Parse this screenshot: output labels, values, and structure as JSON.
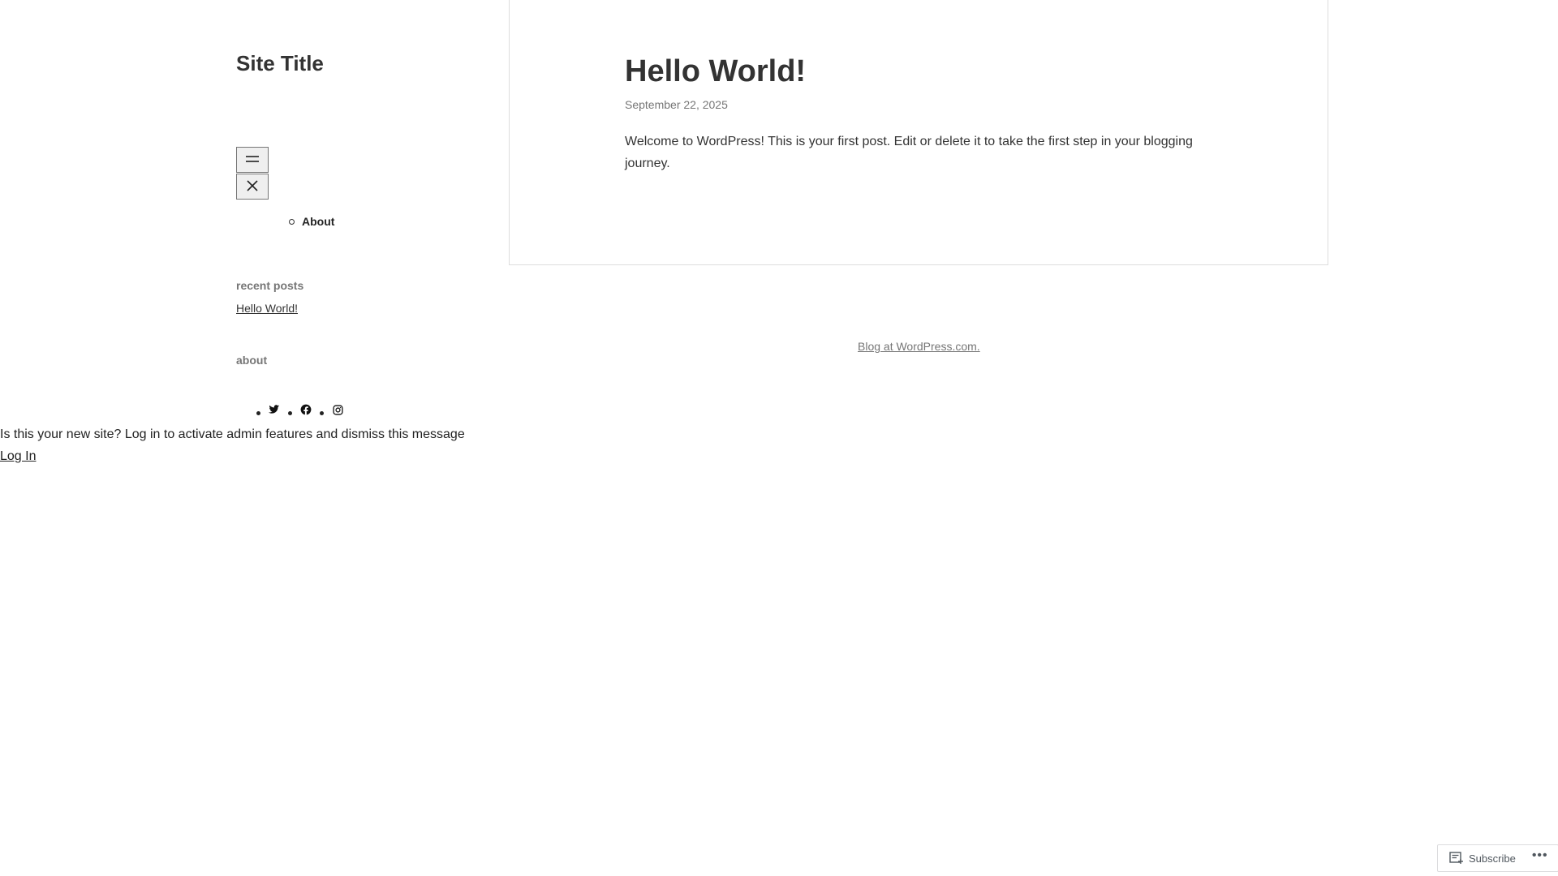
{
  "header": {
    "site_title": "Site Title"
  },
  "navigation": {
    "open_icon": "hamburger-menu-icon",
    "close_icon": "close-icon",
    "items": [
      {
        "label": "About"
      }
    ]
  },
  "sidebar": {
    "recent_posts_title": "recent posts",
    "recent_posts": [
      {
        "label": "Hello World!"
      }
    ],
    "about_title": "about",
    "social_icons": [
      "twitter-icon",
      "facebook-icon",
      "instagram-icon"
    ]
  },
  "post": {
    "title": "Hello World!",
    "date": "September 22, 2025",
    "body": "Welcome to WordPress! This is your first post. Edit or delete it to take the first step in your blogging journey."
  },
  "footer": {
    "credit": "Blog at WordPress.com."
  },
  "notice": {
    "message": "Is this your new site? Log in to activate admin features and dismiss this message",
    "login_label": "Log In"
  },
  "subscribe_bar": {
    "label": "Subscribe",
    "icon": "reader-icon",
    "more": "•••"
  }
}
